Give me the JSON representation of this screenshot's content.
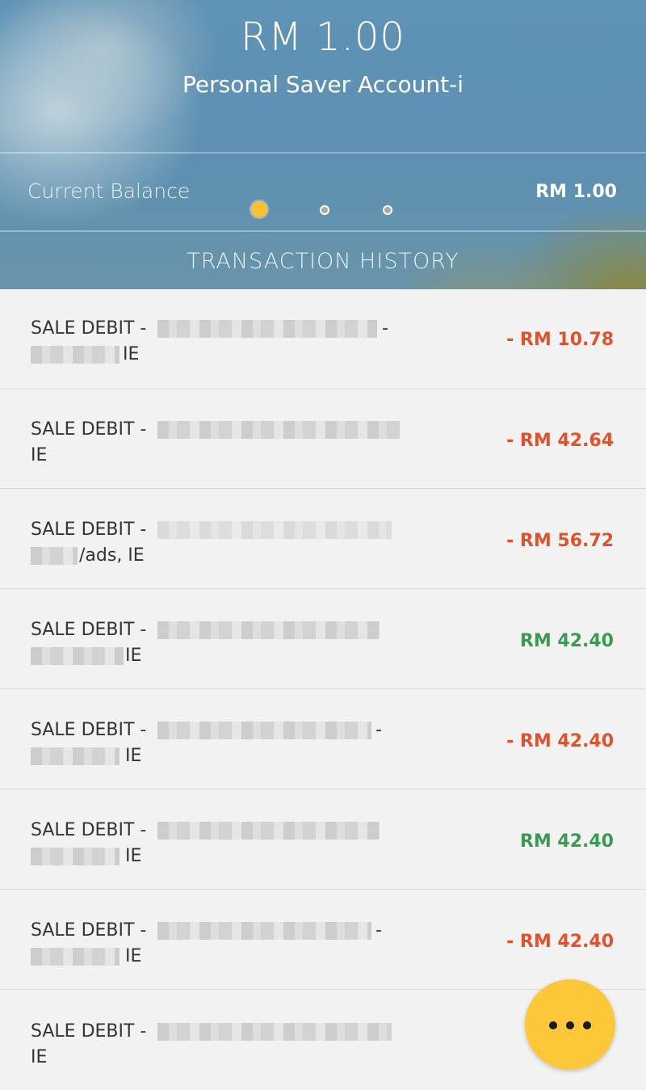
{
  "header": {
    "balance_amount": "RM 1.00",
    "account_name": "Personal Saver Account-i",
    "current_balance_label": "Current Balance",
    "current_balance_value": "RM 1.00",
    "section_title": "TRANSACTION HISTORY",
    "pager": {
      "count": 3,
      "active_index": 0
    }
  },
  "transactions": [
    {
      "line1": "SALE DEBIT -",
      "line1_tail": "-",
      "line2": "IE",
      "amount": "- RM 10.78",
      "type": "debit"
    },
    {
      "line1": "SALE DEBIT -",
      "line1_tail": "",
      "line2": "IE",
      "amount": "- RM 42.64",
      "type": "debit"
    },
    {
      "line1": "SALE DEBIT -",
      "line1_tail": "",
      "line2": "/ads, IE",
      "amount": "- RM 56.72",
      "type": "debit"
    },
    {
      "line1": "SALE DEBIT -",
      "line1_tail": "",
      "line2": "IE",
      "amount": "RM 42.40",
      "type": "credit"
    },
    {
      "line1": "SALE DEBIT -",
      "line1_tail": "-",
      "line2": "IE",
      "amount": "- RM 42.40",
      "type": "debit"
    },
    {
      "line1": "SALE DEBIT -",
      "line1_tail": "",
      "line2": "IE",
      "amount": "RM 42.40",
      "type": "credit"
    },
    {
      "line1": "SALE DEBIT -",
      "line1_tail": "-",
      "line2": "IE",
      "amount": "- RM 42.40",
      "type": "debit"
    },
    {
      "line1": "SALE DEBIT -",
      "line1_tail": "",
      "line2": "IE",
      "amount": "",
      "type": "debit"
    }
  ],
  "fab": {
    "icon": "more-icon"
  },
  "colors": {
    "debit": "#e0512c",
    "credit": "#3a9a52",
    "accent": "#fdc73a"
  }
}
